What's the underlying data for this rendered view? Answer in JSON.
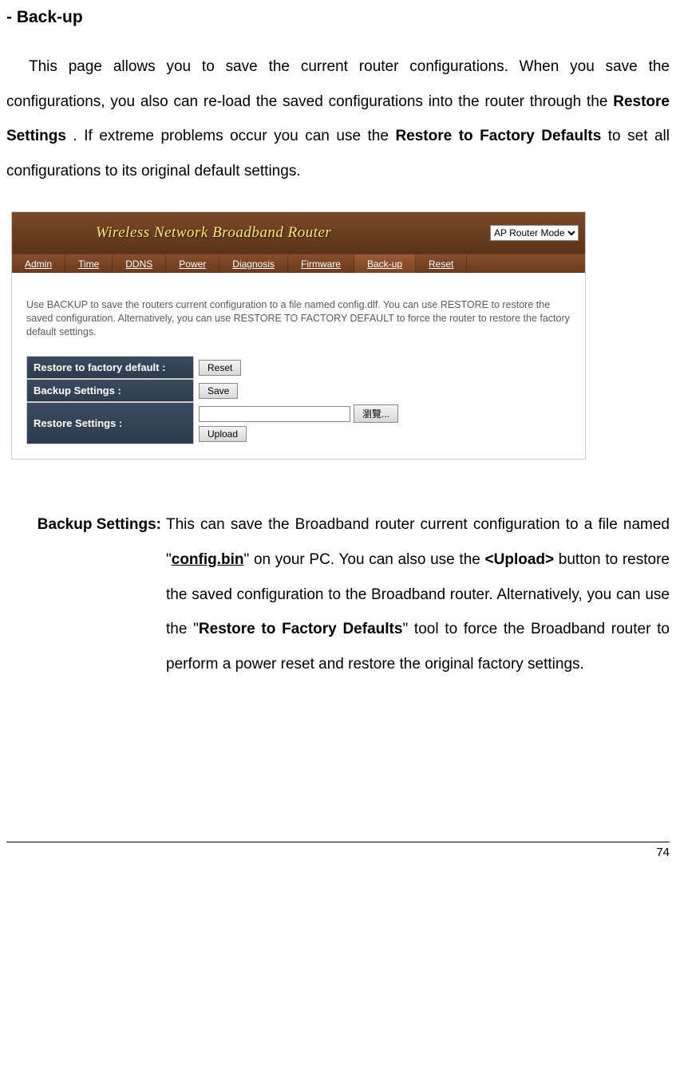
{
  "heading": "- Back-up",
  "intro": {
    "p1a": "This page allows you to save the current router configurations. When you save the configurations, you also can re-load the saved configurations into the router through the ",
    "bold1": "Restore Settings",
    "p1b": ". If extreme problems occur you can use the ",
    "bold2": "Restore to Factory Defaults",
    "p1c": " to set all configurations to its original default settings."
  },
  "router": {
    "title": "Wireless Network Broadband Router",
    "mode_option": "AP Router Mode",
    "tabs": [
      "Admin",
      "Time",
      "DDNS",
      "Power",
      "Diagnosis",
      "Firmware",
      "Back-up",
      "Reset"
    ],
    "active_tab_index": 6,
    "help": "Use BACKUP to save the routers current configuration to a file named config.dlf. You can use RESTORE to restore the saved configuration. Alternatively, you can use RESTORE TO FACTORY DEFAULT to force the router to restore the factory default settings.",
    "rows": {
      "factory_label": "Restore to factory default :",
      "factory_btn": "Reset",
      "backup_label": "Backup Settings :",
      "backup_btn": "Save",
      "restore_label": "Restore Settings :",
      "browse_btn": "瀏覽...",
      "upload_btn": "Upload"
    }
  },
  "definition": {
    "term": "Backup Settings:",
    "b1": "This can save the Broadband router current configuration to a file named \"",
    "config": "config.bin",
    "b2": "\" on your PC. You can also use the ",
    "upload": "<Upload>",
    "b3": " button to restore the saved configuration to the Broadband router. Alternatively, you can use the \"",
    "restore": "Restore to Factory Defaults",
    "b4": "\" tool to force the Broadband router to perform a power reset and restore the original factory settings."
  },
  "page_number": "74"
}
